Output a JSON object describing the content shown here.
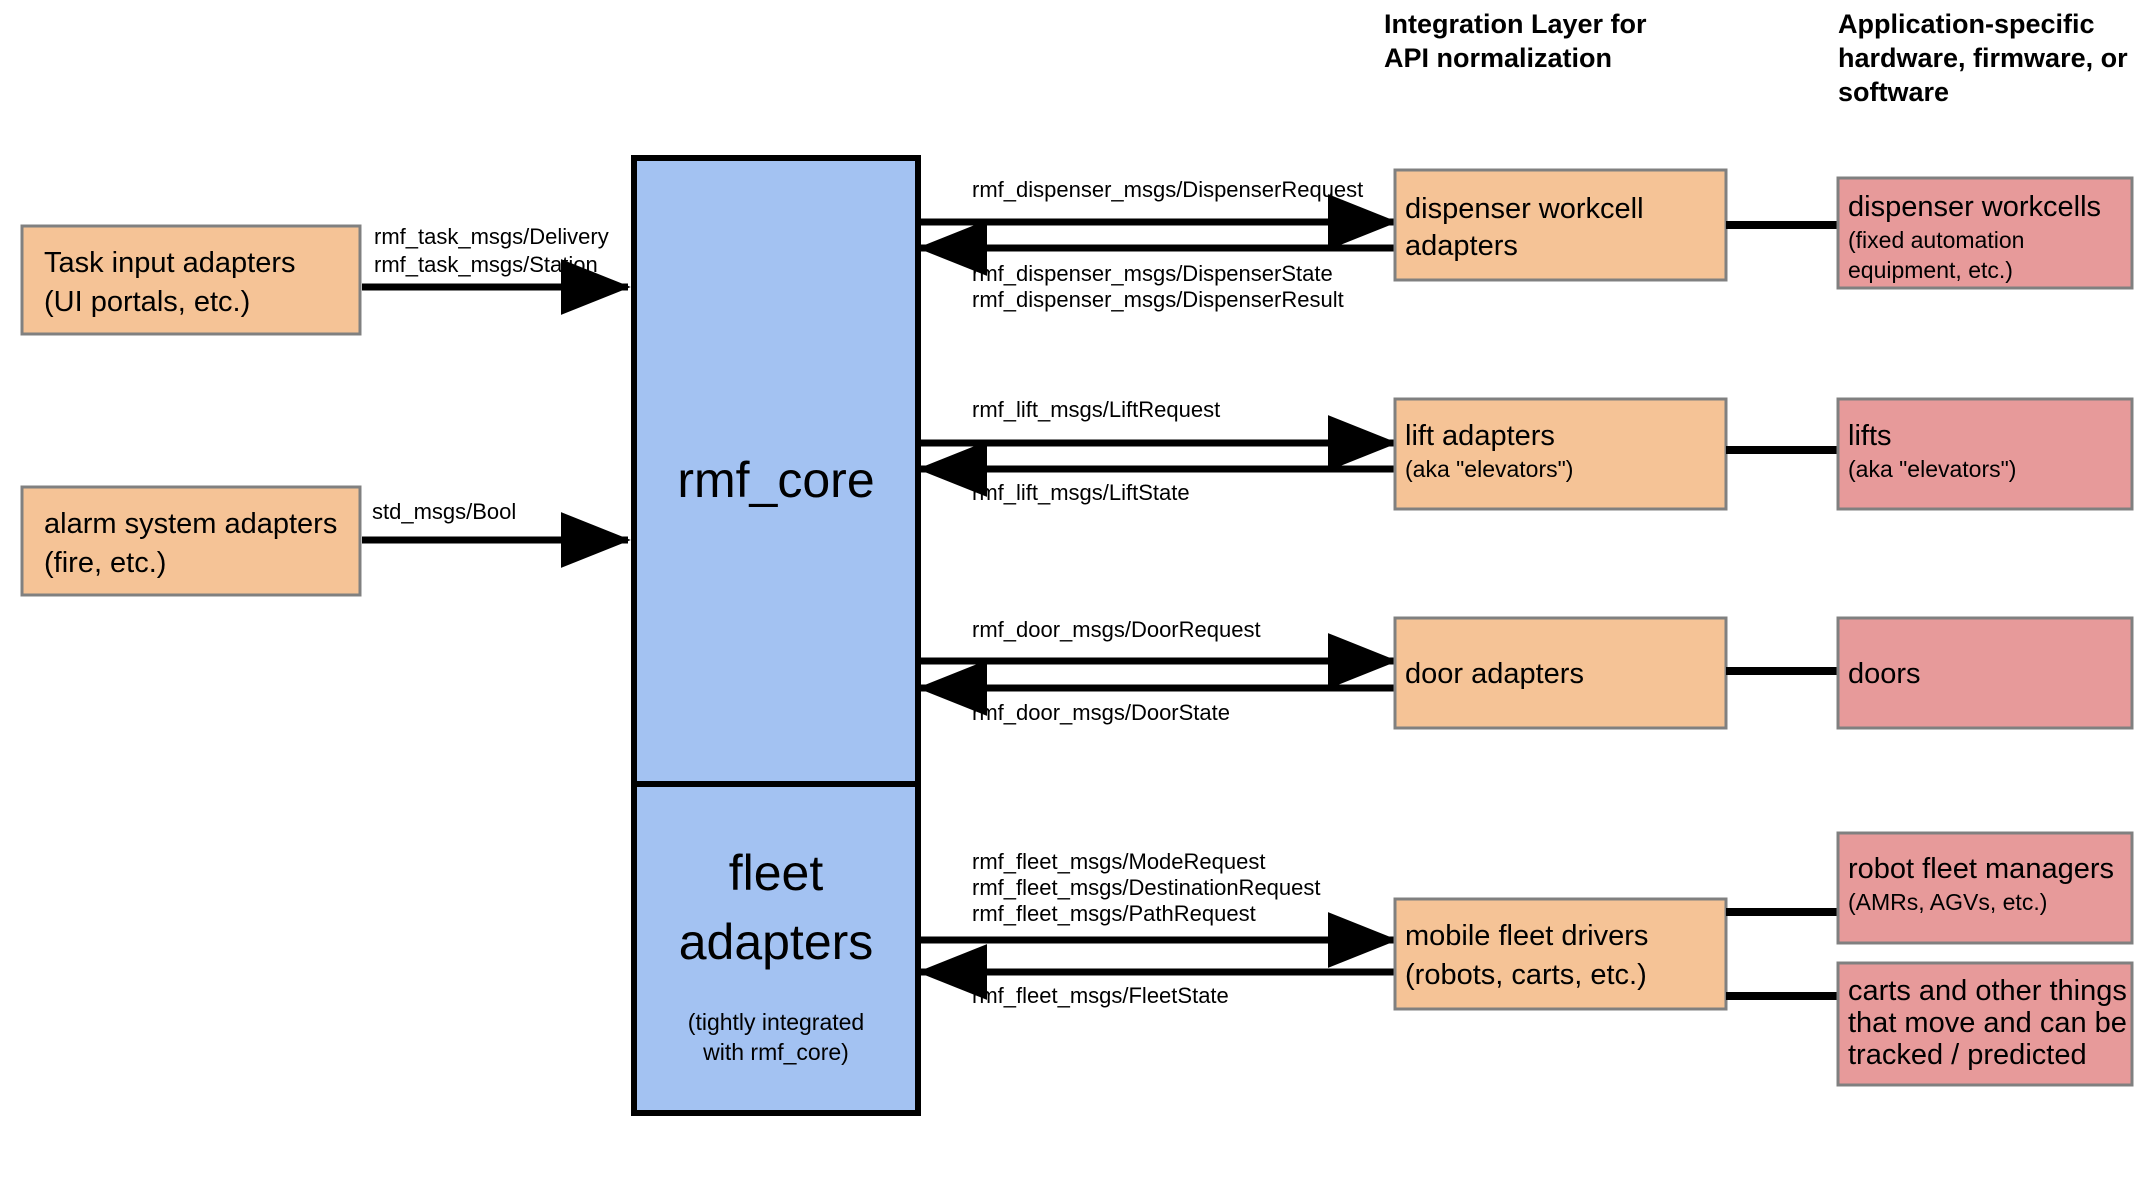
{
  "headers": {
    "integration": "Integration Layer for\nAPI normalization",
    "integration_line1": "Integration Layer for",
    "integration_line2": "API normalization",
    "application": "Application-specific\nhardware, firmware, or\nsoftware",
    "application_line1": "Application-specific",
    "application_line2": "hardware, firmware, or",
    "application_line3": "software"
  },
  "colors": {
    "orange_fill": "#f5c396",
    "pink_fill": "#e79a9a",
    "blue_fill": "#a3c2f2",
    "gray_stroke": "#808080",
    "black_stroke": "#000000",
    "background": "#ffffff"
  },
  "inputs": [
    {
      "id": "task-input-adapters",
      "title": "Task input adapters",
      "subtitle": "(UI portals, etc.)",
      "edge_labels": [
        "rmf_task_msgs/Delivery",
        "rmf_task_msgs/Station"
      ]
    },
    {
      "id": "alarm-system-adapters",
      "title": "alarm system adapters",
      "subtitle": "(fire, etc.)",
      "edge_labels": [
        "std_msgs/Bool"
      ]
    }
  ],
  "core": {
    "title": "rmf_core",
    "fleet_title_line1": "fleet",
    "fleet_title_line2": "adapters",
    "fleet_subtitle_line1": "(tightly integrated",
    "fleet_subtitle_line2": "with rmf_core)"
  },
  "rows": [
    {
      "id": "dispenser",
      "adapter_title": "dispenser workcell",
      "adapter_title_line2": "adapters",
      "adapter_subtitle": "",
      "request_labels": [
        "rmf_dispenser_msgs/DispenserRequest"
      ],
      "state_labels": [
        "rmf_dispenser_msgs/DispenserState",
        "rmf_dispenser_msgs/DispenserResult"
      ],
      "hardware": [
        {
          "title": "dispenser workcells",
          "subtitle_line1": "(fixed automation",
          "subtitle_line2": "equipment, etc.)"
        }
      ]
    },
    {
      "id": "lift",
      "adapter_title": "lift adapters",
      "adapter_title_line2": "",
      "adapter_subtitle": "(aka \"elevators\")",
      "request_labels": [
        "rmf_lift_msgs/LiftRequest"
      ],
      "state_labels": [
        "rmf_lift_msgs/LiftState"
      ],
      "hardware": [
        {
          "title": "lifts",
          "subtitle_line1": "(aka \"elevators\")",
          "subtitle_line2": ""
        }
      ]
    },
    {
      "id": "door",
      "adapter_title": "door adapters",
      "adapter_title_line2": "",
      "adapter_subtitle": "",
      "request_labels": [
        "rmf_door_msgs/DoorRequest"
      ],
      "state_labels": [
        "rmf_door_msgs/DoorState"
      ],
      "hardware": [
        {
          "title": "doors",
          "subtitle_line1": "",
          "subtitle_line2": ""
        }
      ]
    },
    {
      "id": "fleet",
      "adapter_title": "mobile fleet drivers",
      "adapter_title_line2": "(robots, carts, etc.)",
      "adapter_subtitle": "",
      "request_labels": [
        "rmf_fleet_msgs/ModeRequest",
        "rmf_fleet_msgs/DestinationRequest",
        "rmf_fleet_msgs/PathRequest"
      ],
      "state_labels": [
        "rmf_fleet_msgs/FleetState"
      ],
      "hardware": [
        {
          "title": "robot fleet managers",
          "subtitle_line1": "(AMRs, AGVs, etc.)",
          "subtitle_line2": ""
        },
        {
          "title": "carts and other things",
          "subtitle_line1": "that move and can be",
          "subtitle_line2": "tracked / predicted"
        }
      ]
    }
  ]
}
